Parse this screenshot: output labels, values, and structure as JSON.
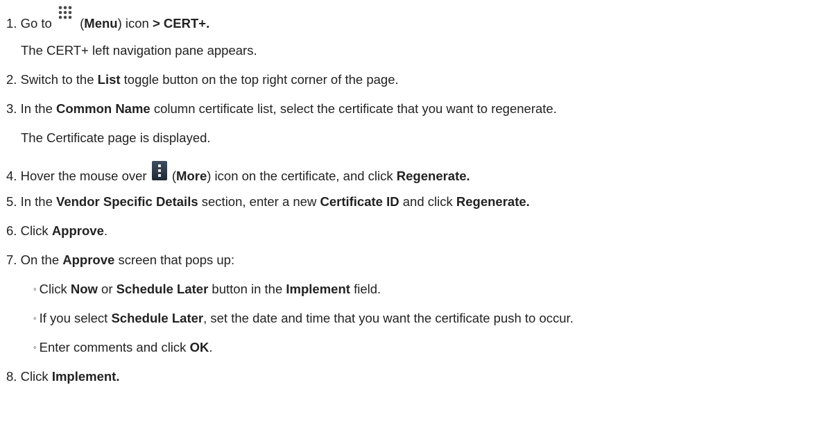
{
  "steps": {
    "s1": {
      "num": "1.",
      "t1": "Go to",
      "t2": "(",
      "b1": "Menu",
      "t3": ") icon",
      "b2": "> CERT+.",
      "sub": "The CERT+ left navigation pane appears."
    },
    "s2": {
      "num": "2.",
      "t1": "Switch to the",
      "b1": "List",
      "t2": "toggle button on the top right corner of the page."
    },
    "s3": {
      "num": "3.",
      "t1": "In the",
      "b1": "Common Name",
      "t2": "column certificate list, select the certificate that you want to regenerate.",
      "sub": "The Certificate page is displayed."
    },
    "s4": {
      "num": "4.",
      "t1": "Hover the mouse over",
      "t2": "(",
      "b1": "More",
      "t3": ") icon on the certificate, and click",
      "b2": "Regenerate."
    },
    "s5": {
      "num": "5.",
      "t1": "In the",
      "b1": "Vendor Specific Details",
      "t2": "section, enter a new",
      "b2": "Certificate ID",
      "t3": "and click",
      "b3": "Regenerate."
    },
    "s6": {
      "num": "6.",
      "t1": "Click",
      "b1": "Approve",
      "t2": "."
    },
    "s7": {
      "num": "7.",
      "t1": "On the",
      "b1": "Approve",
      "t2": "screen that pops up:",
      "bullets": {
        "b1": {
          "mark": "◦",
          "t1": "Click",
          "b1": "Now",
          "t2": "or",
          "b2": "Schedule Later",
          "t3": "button in the",
          "b3": "Implement",
          "t4": "field."
        },
        "b2": {
          "mark": "◦",
          "t1": "If you select",
          "b1": "Schedule Later",
          "t2": ", set the date and time that you want the certificate push to occur."
        },
        "b3": {
          "mark": "◦",
          "t1": "Enter comments and click",
          "b1": "OK",
          "t2": "."
        }
      }
    },
    "s8": {
      "num": "8.",
      "t1": "Click",
      "b1": "Implement."
    }
  },
  "icons": {
    "menu": "grid-dots-icon",
    "more": "vertical-dots-icon"
  }
}
